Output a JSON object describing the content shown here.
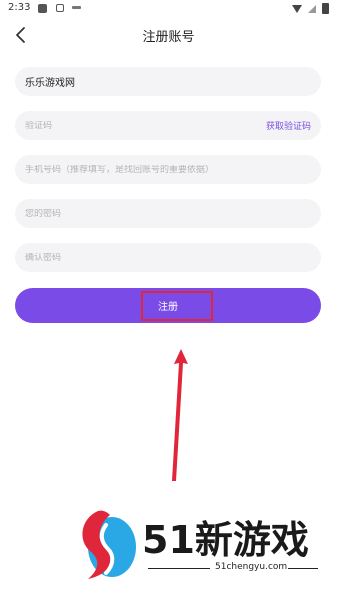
{
  "status_bar": {
    "time": "2:33"
  },
  "header": {
    "title": "注册账号"
  },
  "form": {
    "game_name_value": "乐乐游戏网",
    "code_placeholder": "验证码",
    "get_code_label": "获取验证码",
    "phone_placeholder": "手机号码（推荐填写，是找回账号的重要依据）",
    "password_placeholder": "您的密码",
    "confirm_placeholder": "确认密码",
    "register_label": "注册"
  },
  "watermark": {
    "brand": "51新游戏",
    "url": "51chengyu.com"
  },
  "colors": {
    "accent": "#7b4be8",
    "highlight": "#e0263a",
    "field_bg": "#f4f4f6"
  }
}
